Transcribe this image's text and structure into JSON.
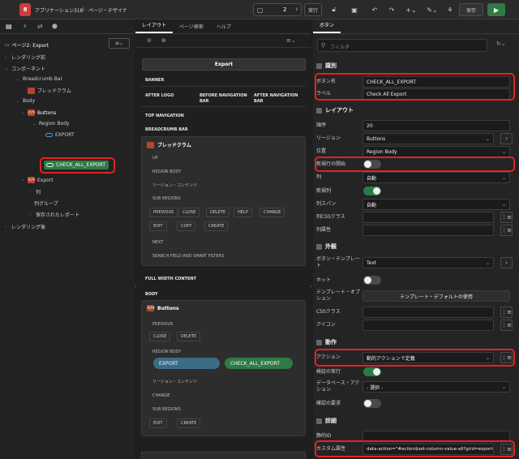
{
  "toolbar": {
    "app_title": "アプリケーション318",
    "page_title": "ページ・デザイナ",
    "page_number": "2",
    "run_label": "実行",
    "save_label": "保存"
  },
  "left": {
    "page_label": "ページ2: Export",
    "tree": {
      "before_render": "レンダリング前",
      "components": "コンポーネント",
      "breadcrumb_bar": "Breadcrumb Bar",
      "breadcrumb": "ブレッドクラム",
      "body": "Body",
      "buttons": "Buttons",
      "region_body": "Region Body",
      "export_btn": "EXPORT",
      "check_all_export": "CHECK_ALL_EXPORT",
      "export_region": "Export",
      "columns": "列",
      "column_groups": "列グループ",
      "saved_reports": "保存されたレポート",
      "after_render": "レンダリング後"
    }
  },
  "middle": {
    "tabs": [
      "レイアウト",
      "ページ検索",
      "ヘルプ"
    ],
    "export_header": "Export",
    "banner": "BANNER",
    "after_logo": "AFTER LOGO",
    "before_nav": "BEFORE NAVIGATION BAR",
    "after_nav": "AFTER NAVIGATION BAR",
    "top_nav": "TOP NAVIGATION",
    "breadcrumb_bar": "BREADCRUMB BAR",
    "breadcrumb_card": "ブレッドクラム",
    "bc_items": {
      "up": "UP",
      "region_body": "REGION BODY",
      "region_content": "リージョン・コンテンツ",
      "sub_regions": "SUB REGIONS",
      "previous": "PREVIOUS",
      "close": "CLOSE",
      "delete": "DELETE",
      "help": "HELP",
      "change": "CHANGE",
      "edit": "EDIT",
      "copy": "COPY",
      "create": "CREATE",
      "next": "NEXT",
      "search_field": "SEARCH FIELD AND SMART FILTERS"
    },
    "full_width": "FULL WIDTH CONTENT",
    "body": "BODY",
    "buttons_card": "Buttons",
    "btn_items": {
      "previous": "PREVIOUS",
      "close": "CLOSE",
      "delete": "DELETE",
      "region_body": "REGION BODY",
      "export": "EXPORT",
      "check_all": "CHECK_ALL_EXPORT",
      "region_content": "リージョン・コンテンツ",
      "change": "CHANGE",
      "sub_regions": "SUB REGIONS",
      "edit": "EDIT",
      "create": "CREATE"
    }
  },
  "right": {
    "tab": "ボタン",
    "filter_placeholder": "フィルタ",
    "groups": {
      "identification": "識別",
      "layout": "レイアウト",
      "appearance": "外観",
      "behavior": "動作",
      "advanced": "詳細"
    },
    "props": {
      "button_name_label": "ボタン名",
      "button_name": "CHECK_ALL_EXPORT",
      "label_label": "ラベル",
      "label": "Check All Export",
      "sequence_label": "順序",
      "sequence": "20",
      "region_label": "リージョン",
      "region": "Buttons",
      "position_label": "位置",
      "position": "Region Body",
      "new_row_start_label": "新規行の開始",
      "column_label": "列",
      "column": "自動",
      "new_column_label": "新規列",
      "column_span_label": "列スパン",
      "column_span": "自動",
      "column_css_label": "列CSSクラス",
      "column_attr_label": "列属性",
      "button_template_label": "ボタン・テンプレート",
      "button_template": "Text",
      "hot_label": "ホット",
      "template_options_label": "テンプレート・オプション",
      "template_options_btn": "テンプレート・デフォルトの使用",
      "css_class_label": "CSSクラス",
      "icon_label": "アイコン",
      "action_label": "アクション",
      "action": "動的アクションで定義",
      "validate_label": "検証の実行",
      "db_action_label": "データベース・アクション",
      "db_action": "- 選択 -",
      "confirm_label": "確認の要求",
      "static_id_label": "静的ID",
      "custom_attr_label": "カスタム属性",
      "custom_attr": "data-action=\"#action$set-column-value-all?grid=export-gr"
    }
  }
}
